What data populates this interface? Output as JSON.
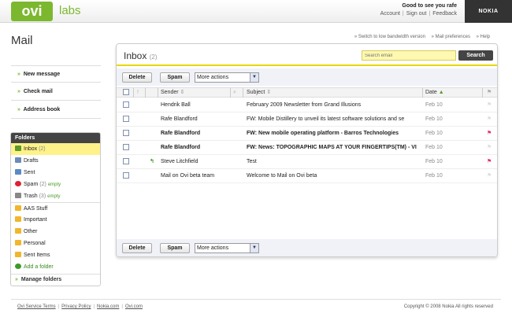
{
  "header": {
    "logo_text": "ovi",
    "labs_text": "labs",
    "greeting": "Good to see you rafe",
    "links": [
      "Account",
      "Sign out",
      "Feedback"
    ],
    "brand": "NOKIA"
  },
  "app_title": "Mail",
  "util_links": [
    "» Switch to low bandwidth version",
    "» Mail preferences",
    "» Help"
  ],
  "actions": [
    "New message",
    "Check mail",
    "Address book"
  ],
  "folders": {
    "title": "Folders",
    "items": [
      {
        "label": "Inbox",
        "count": "(2)",
        "icon": "inbox-icon"
      },
      {
        "label": "Drafts",
        "count": "",
        "icon": "drafts-icon"
      },
      {
        "label": "Sent",
        "count": "",
        "icon": "sent-icon"
      },
      {
        "label": "Spam",
        "count": "(2)",
        "empty": "empty",
        "icon": "spam-icon"
      },
      {
        "label": "Trash",
        "count": "(3)",
        "empty": "empty",
        "icon": "trash-icon"
      },
      {
        "label": "AAS Stuff",
        "icon": "folder-icon"
      },
      {
        "label": "Important",
        "icon": "folder-icon"
      },
      {
        "label": "Other",
        "icon": "folder-icon"
      },
      {
        "label": "Personal",
        "icon": "folder-icon"
      },
      {
        "label": "Sent Items",
        "icon": "folder-icon"
      },
      {
        "label": "Add a folder",
        "icon": "add-icon"
      }
    ],
    "manage": "Manage folders"
  },
  "inbox": {
    "title": "Inbox",
    "count": "(2)",
    "search_placeholder": "Search email",
    "search_button": "Search",
    "delete_label": "Delete",
    "spam_label": "Spam",
    "more_actions": "More actions",
    "columns": {
      "sender": "Sender",
      "subject": "Subject",
      "date": "Date"
    },
    "messages": [
      {
        "sender": "Hendrik Ball",
        "subject": "February 2009 Newsletter from Grand Illusions",
        "date": "Feb 10",
        "unread": false,
        "replied": false,
        "flagged": false
      },
      {
        "sender": "Rafe Blandford",
        "subject": "FW: Mobile Distillery to unveil its latest software solutions and se",
        "date": "Feb 10",
        "unread": false,
        "replied": false,
        "flagged": false
      },
      {
        "sender": "Rafe Blandford",
        "subject": "FW: New mobile operating platform - Barros Technologies",
        "date": "Feb 10",
        "unread": true,
        "replied": false,
        "flagged": true
      },
      {
        "sender": "Rafe Blandford",
        "subject": "FW: News: TOPOGRAPHIC MAPS AT YOUR FINGERTIPS(TM) - VI",
        "date": "Feb 10",
        "unread": true,
        "replied": false,
        "flagged": false
      },
      {
        "sender": "Steve Litchfield",
        "subject": "Test",
        "date": "Feb 10",
        "unread": false,
        "replied": true,
        "flagged": true
      },
      {
        "sender": "Mail on Ovi beta team",
        "subject": "Welcome to Mail on Ovi beta",
        "date": "Feb 10",
        "unread": false,
        "replied": false,
        "flagged": false
      }
    ]
  },
  "footer": {
    "links": [
      "Ovi Service Terms",
      "Privacy Policy",
      "Nokia.com",
      "Ovi.com"
    ],
    "copyright": "Copyright © 2008 Nokia All rights reserved"
  },
  "colors": {
    "accent_green": "#7cb82f",
    "search_yellow": "#fff8b0",
    "selected_folder": "#fff28a"
  }
}
